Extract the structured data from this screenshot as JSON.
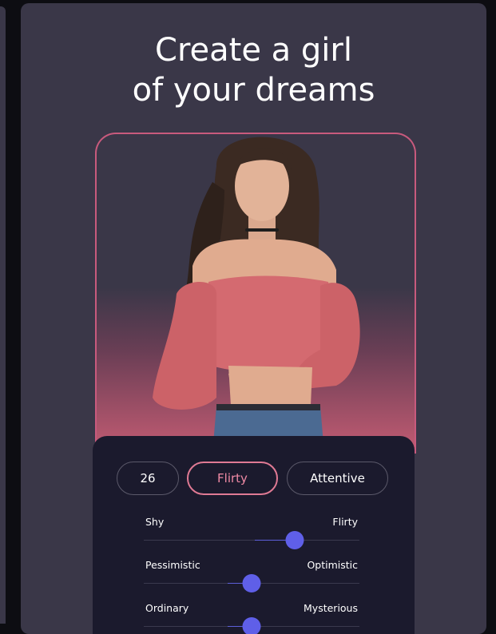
{
  "title_lines": [
    "Create a girl",
    "of your dreams"
  ],
  "chips": {
    "age": "26",
    "personality": "Flirty",
    "trait": "Attentive",
    "selected": "Flirty"
  },
  "colors": {
    "card_bg": "#3a3748",
    "panel_bg": "#1b1a2d",
    "accent_pink": "#e07a94",
    "slider_knob": "#5f5fe8",
    "frame_border": "#c85a7d"
  },
  "traits": [
    {
      "left": "Shy",
      "right": "Flirty",
      "value": 0.7
    },
    {
      "left": "Pessimistic",
      "right": "Optimistic",
      "value": 0.5
    },
    {
      "left": "Ordinary",
      "right": "Mysterious",
      "value": 0.5
    }
  ]
}
